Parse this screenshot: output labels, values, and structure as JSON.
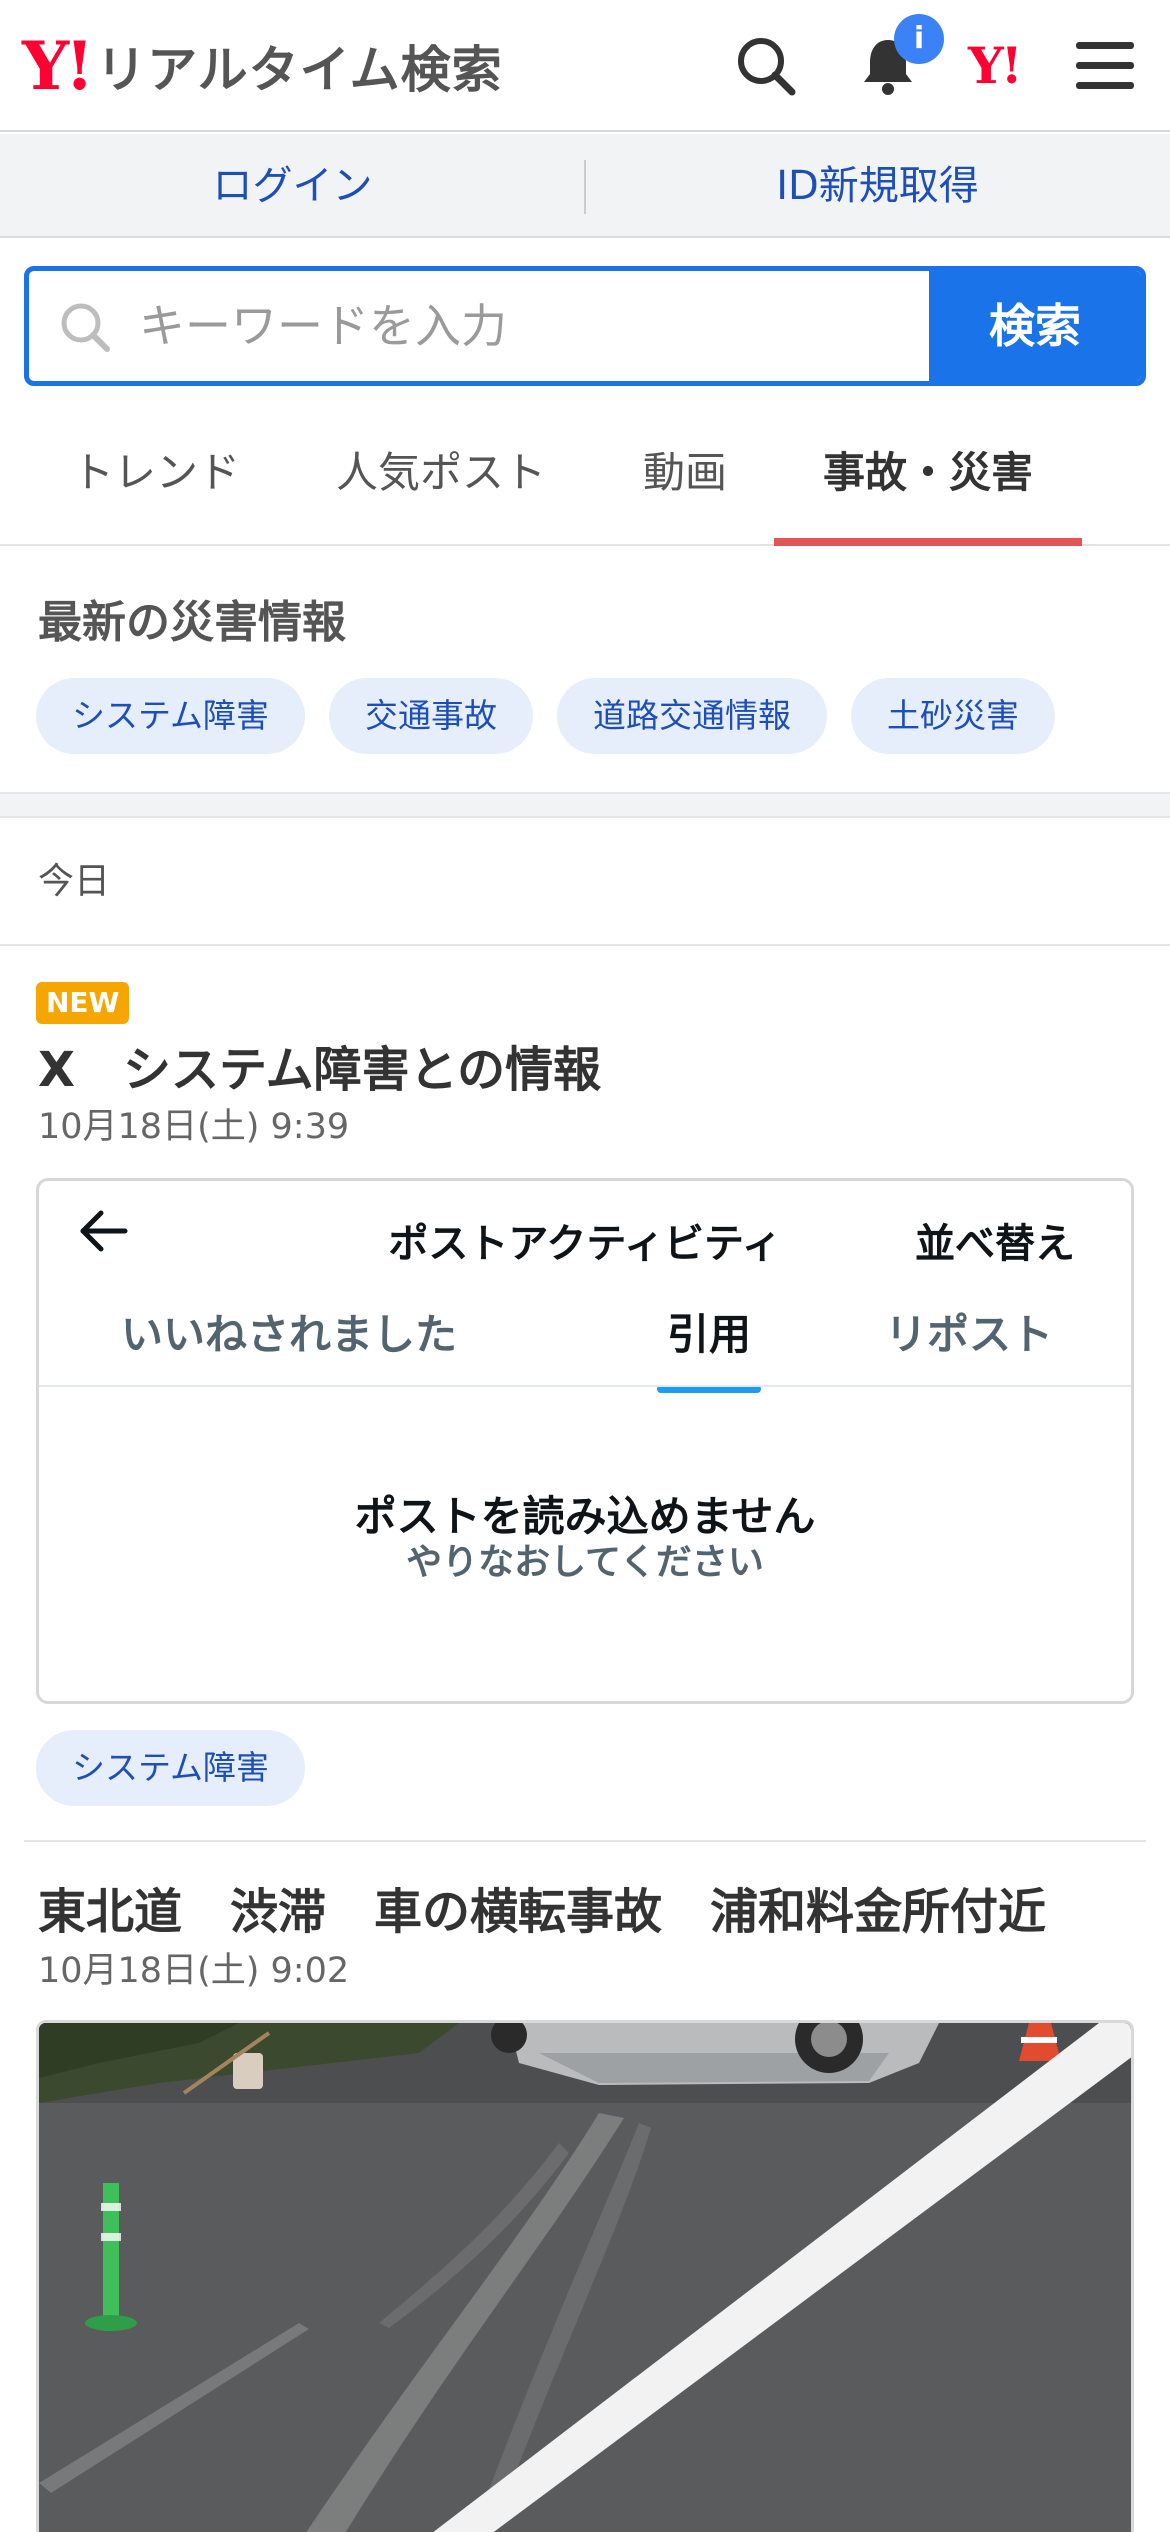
{
  "header": {
    "logo_mark": "Y!",
    "logo_text": "リアルタイム検索",
    "notification_badge": "i",
    "yahoo_mini": "Y!"
  },
  "login_bar": {
    "login_label": "ログイン",
    "register_label": "ID新規取得"
  },
  "search": {
    "placeholder": "キーワードを入力",
    "button_label": "検索"
  },
  "tabs": [
    {
      "label": "トレンド",
      "active": false
    },
    {
      "label": "人気ポスト",
      "active": false
    },
    {
      "label": "動画",
      "active": false
    },
    {
      "label": "事故・災害",
      "active": true
    }
  ],
  "disaster": {
    "title": "最新の災害情報",
    "chips": [
      "システム障害",
      "交通事故",
      "道路交通情報",
      "土砂災害"
    ]
  },
  "date_header": "今日",
  "articles": [
    {
      "badge": "NEW",
      "title": "X　システム障害との情報",
      "date": "10月18日(土) 9:39",
      "embed": {
        "title": "ポストアクティビティ",
        "sort_label": "並べ替え",
        "tabs": [
          "いいねされました",
          "引用",
          "リポスト"
        ],
        "active_tab": "引用",
        "error_main": "ポストを読み込めません",
        "error_sub": "やりなおしてください"
      },
      "tag": "システム障害"
    },
    {
      "title": "東北道　渋滞　車の横転事故　浦和料金所付近",
      "date": "10月18日(土) 9:02"
    }
  ],
  "colors": {
    "brand_red": "#ff0033",
    "accent_blue": "#1a73e8",
    "active_tab_underline": "#e25555",
    "new_badge": "#f5a600",
    "chip_bg": "#e7eefb"
  }
}
